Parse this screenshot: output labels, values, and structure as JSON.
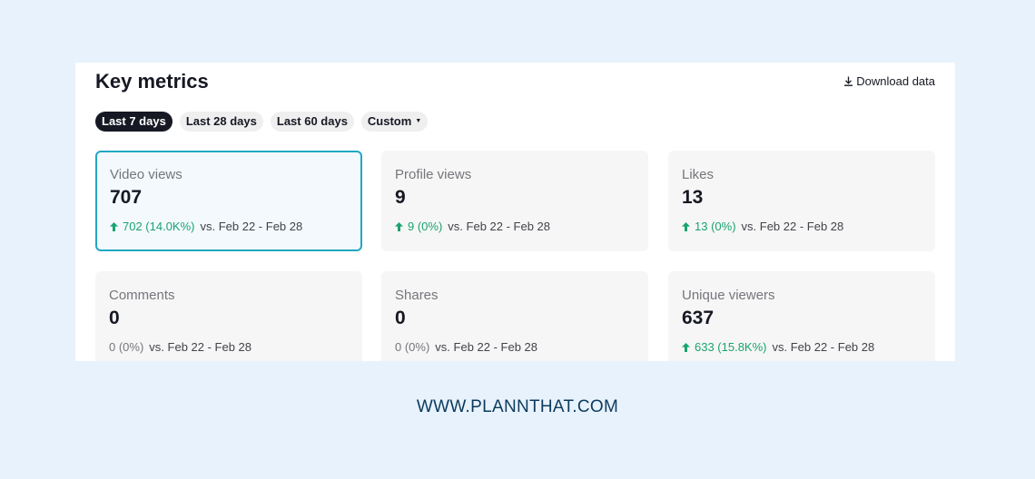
{
  "header": {
    "title": "Key metrics",
    "download_label": "Download data"
  },
  "tabs": [
    {
      "label": "Last 7 days",
      "active": true
    },
    {
      "label": "Last 28 days",
      "active": false
    },
    {
      "label": "Last 60 days",
      "active": false
    },
    {
      "label": "Custom",
      "active": false
    }
  ],
  "metrics": [
    {
      "label": "Video views",
      "value": "707",
      "delta": "702 (14.0K%)",
      "trend": "up",
      "comparison": "vs. Feb 22 - Feb 28",
      "selected": true
    },
    {
      "label": "Profile views",
      "value": "9",
      "delta": "9 (0%)",
      "trend": "up",
      "comparison": "vs. Feb 22 - Feb 28",
      "selected": false
    },
    {
      "label": "Likes",
      "value": "13",
      "delta": "13 (0%)",
      "trend": "up",
      "comparison": "vs. Feb 22 - Feb 28",
      "selected": false
    },
    {
      "label": "Comments",
      "value": "0",
      "delta": "0 (0%)",
      "trend": "none",
      "comparison": "vs. Feb 22 - Feb 28",
      "selected": false
    },
    {
      "label": "Shares",
      "value": "0",
      "delta": "0 (0%)",
      "trend": "none",
      "comparison": "vs. Feb 22 - Feb 28",
      "selected": false
    },
    {
      "label": "Unique viewers",
      "value": "637",
      "delta": "633 (15.8K%)",
      "trend": "up",
      "comparison": "vs. Feb 22 - Feb 28",
      "selected": false
    }
  ],
  "footer": {
    "text": "WWW.PLANNTHAT.COM"
  },
  "colors": {
    "accent_border": "#21a7c3",
    "positive": "#1aa36f",
    "active_tab": "#161823",
    "background": "#e7f2fc"
  }
}
